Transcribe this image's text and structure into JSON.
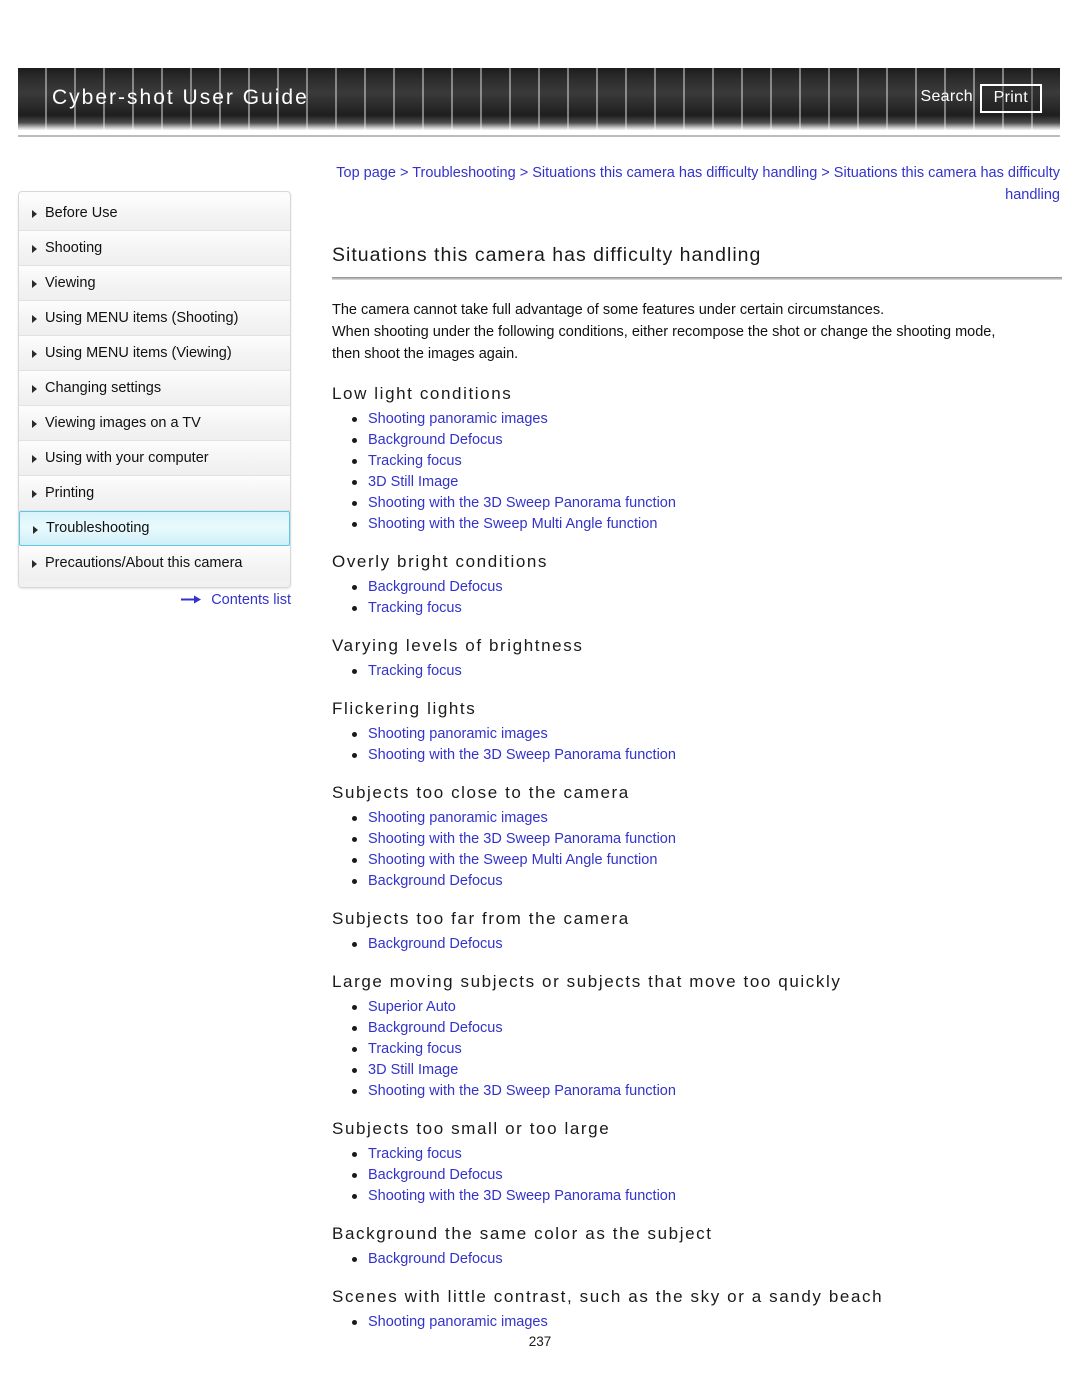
{
  "header": {
    "guide_title": "Cyber-shot User Guide",
    "search_label": "Search",
    "print_label": "Print"
  },
  "breadcrumb": {
    "items": [
      "Top page",
      "Troubleshooting",
      "Situations this camera has difficulty handling",
      "Situations this camera has difficulty handling"
    ],
    "separator": ">"
  },
  "sidebar": {
    "items": [
      {
        "label": "Before Use",
        "active": false
      },
      {
        "label": "Shooting",
        "active": false
      },
      {
        "label": "Viewing",
        "active": false
      },
      {
        "label": "Using MENU items (Shooting)",
        "active": false
      },
      {
        "label": "Using MENU items (Viewing)",
        "active": false
      },
      {
        "label": "Changing settings",
        "active": false
      },
      {
        "label": "Viewing images on a TV",
        "active": false
      },
      {
        "label": "Using with your computer",
        "active": false
      },
      {
        "label": "Printing",
        "active": false
      },
      {
        "label": "Troubleshooting",
        "active": true
      },
      {
        "label": "Precautions/About this camera",
        "active": false
      }
    ],
    "contents_list_label": "Contents list"
  },
  "main": {
    "title": "Situations this camera has difficulty handling",
    "intro": [
      "The camera cannot take full advantage of some features under certain circumstances.",
      "When shooting under the following conditions, either recompose the shot or change the shooting mode,",
      "then shoot the images again."
    ],
    "sections": [
      {
        "heading": "Low light conditions",
        "links": [
          "Shooting panoramic images",
          "Background Defocus",
          "Tracking focus",
          "3D Still Image",
          "Shooting with the 3D Sweep Panorama function",
          "Shooting with the Sweep Multi Angle function"
        ]
      },
      {
        "heading": "Overly bright conditions",
        "links": [
          "Background Defocus",
          "Tracking focus"
        ]
      },
      {
        "heading": "Varying levels of brightness",
        "links": [
          "Tracking focus"
        ]
      },
      {
        "heading": "Flickering lights",
        "links": [
          "Shooting panoramic images",
          "Shooting with the 3D Sweep Panorama function"
        ]
      },
      {
        "heading": "Subjects too close to the camera",
        "links": [
          "Shooting panoramic images",
          "Shooting with the 3D Sweep Panorama function",
          "Shooting with the Sweep Multi Angle function",
          "Background Defocus"
        ]
      },
      {
        "heading": "Subjects too far from the camera",
        "links": [
          "Background Defocus"
        ]
      },
      {
        "heading": "Large moving subjects or subjects that move too quickly",
        "links": [
          "Superior Auto",
          "Background Defocus",
          "Tracking focus",
          "3D Still Image",
          "Shooting with the 3D Sweep Panorama function"
        ]
      },
      {
        "heading": "Subjects too small or too large",
        "links": [
          "Tracking focus",
          "Background Defocus",
          "Shooting with the 3D Sweep Panorama function"
        ]
      },
      {
        "heading": "Background the same color as the subject",
        "links": [
          "Background Defocus"
        ]
      },
      {
        "heading": "Scenes with little contrast, such as the sky or a sandy beach",
        "links": [
          "Shooting panoramic images"
        ]
      }
    ]
  },
  "footer": {
    "page_number": "237"
  },
  "colors": {
    "link": "#3333CC",
    "header_bg": "#2A2A2A",
    "active_nav": "#CFEEF8",
    "text": "#111111"
  }
}
